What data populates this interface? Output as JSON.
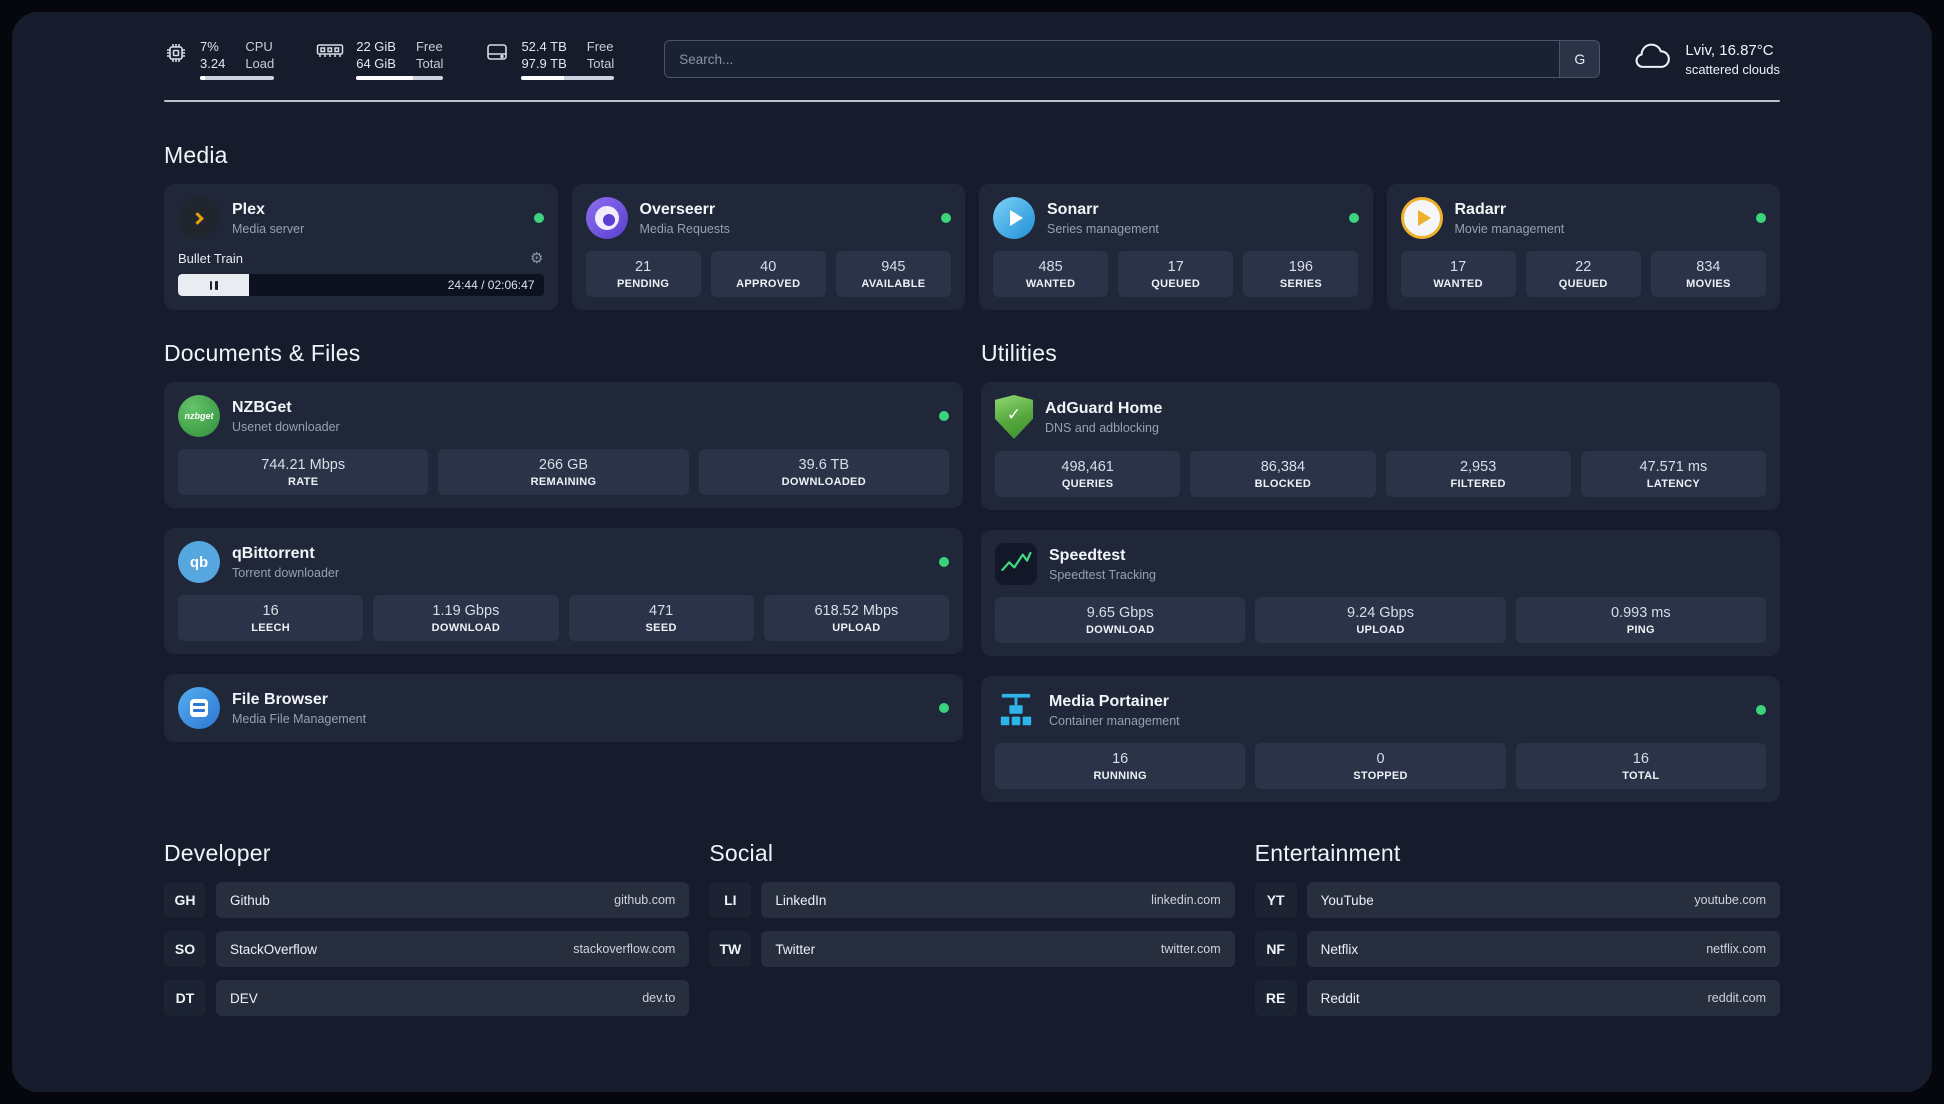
{
  "colors": {
    "accent_green": "#3bd37c",
    "background": "#161c2c",
    "card": "#1f2738",
    "tile": "#2a3347"
  },
  "topbar": {
    "system": [
      {
        "icon": "cpu-icon",
        "values": [
          "7%",
          "3.24"
        ],
        "labels": [
          "CPU",
          "Load"
        ]
      },
      {
        "icon": "memory-icon",
        "values": [
          "22 GiB",
          "64 GiB"
        ],
        "labels": [
          "Free",
          "Total"
        ]
      },
      {
        "icon": "disk-icon",
        "values": [
          "52.4 TB",
          "97.9 TB"
        ],
        "labels": [
          "Free",
          "Total"
        ]
      }
    ],
    "search": {
      "placeholder": "Search...",
      "engine_button": "G"
    },
    "weather": {
      "location": "Lviv, 16.87°C",
      "condition": "scattered clouds"
    }
  },
  "media": {
    "heading": "Media",
    "plex": {
      "title": "Plex",
      "subtitle": "Media server",
      "now_playing": "Bullet Train",
      "time": "24:44 / 02:06:47"
    },
    "overseerr": {
      "title": "Overseerr",
      "subtitle": "Media Requests",
      "stats": [
        {
          "value": "21",
          "label": "PENDING"
        },
        {
          "value": "40",
          "label": "APPROVED"
        },
        {
          "value": "945",
          "label": "AVAILABLE"
        }
      ]
    },
    "sonarr": {
      "title": "Sonarr",
      "subtitle": "Series management",
      "stats": [
        {
          "value": "485",
          "label": "WANTED"
        },
        {
          "value": "17",
          "label": "QUEUED"
        },
        {
          "value": "196",
          "label": "SERIES"
        }
      ]
    },
    "radarr": {
      "title": "Radarr",
      "subtitle": "Movie management",
      "stats": [
        {
          "value": "17",
          "label": "WANTED"
        },
        {
          "value": "22",
          "label": "QUEUED"
        },
        {
          "value": "834",
          "label": "MOVIES"
        }
      ]
    }
  },
  "documents": {
    "heading": "Documents & Files",
    "nzbget": {
      "title": "NZBGet",
      "subtitle": "Usenet downloader",
      "stats": [
        {
          "value": "744.21 Mbps",
          "label": "RATE"
        },
        {
          "value": "266 GB",
          "label": "REMAINING"
        },
        {
          "value": "39.6 TB",
          "label": "DOWNLOADED"
        }
      ]
    },
    "qbittorrent": {
      "title": "qBittorrent",
      "subtitle": "Torrent downloader",
      "stats": [
        {
          "value": "16",
          "label": "LEECH"
        },
        {
          "value": "1.19 Gbps",
          "label": "DOWNLOAD"
        },
        {
          "value": "471",
          "label": "SEED"
        },
        {
          "value": "618.52 Mbps",
          "label": "UPLOAD"
        }
      ]
    },
    "filebrowser": {
      "title": "File Browser",
      "subtitle": "Media File Management"
    }
  },
  "utilities": {
    "heading": "Utilities",
    "adguard": {
      "title": "AdGuard Home",
      "subtitle": "DNS and adblocking",
      "stats": [
        {
          "value": "498,461",
          "label": "QUERIES"
        },
        {
          "value": "86,384",
          "label": "BLOCKED"
        },
        {
          "value": "2,953",
          "label": "FILTERED"
        },
        {
          "value": "47.571 ms",
          "label": "LATENCY"
        }
      ]
    },
    "speedtest": {
      "title": "Speedtest",
      "subtitle": "Speedtest Tracking",
      "stats": [
        {
          "value": "9.65 Gbps",
          "label": "DOWNLOAD"
        },
        {
          "value": "9.24 Gbps",
          "label": "UPLOAD"
        },
        {
          "value": "0.993 ms",
          "label": "PING"
        }
      ]
    },
    "portainer": {
      "title": "Media Portainer",
      "subtitle": "Container management",
      "stats": [
        {
          "value": "16",
          "label": "RUNNING"
        },
        {
          "value": "0",
          "label": "STOPPED"
        },
        {
          "value": "16",
          "label": "TOTAL"
        }
      ]
    }
  },
  "links": {
    "developer": {
      "heading": "Developer",
      "items": [
        {
          "abbr": "GH",
          "name": "Github",
          "url": "github.com"
        },
        {
          "abbr": "SO",
          "name": "StackOverflow",
          "url": "stackoverflow.com"
        },
        {
          "abbr": "DT",
          "name": "DEV",
          "url": "dev.to"
        }
      ]
    },
    "social": {
      "heading": "Social",
      "items": [
        {
          "abbr": "LI",
          "name": "LinkedIn",
          "url": "linkedin.com"
        },
        {
          "abbr": "TW",
          "name": "Twitter",
          "url": "twitter.com"
        }
      ]
    },
    "entertainment": {
      "heading": "Entertainment",
      "items": [
        {
          "abbr": "YT",
          "name": "YouTube",
          "url": "youtube.com"
        },
        {
          "abbr": "NF",
          "name": "Netflix",
          "url": "netflix.com"
        },
        {
          "abbr": "RE",
          "name": "Reddit",
          "url": "reddit.com"
        }
      ]
    }
  },
  "icons": {
    "gear": "⚙",
    "adguard_check": "✓",
    "nzbget_label": "nzbget",
    "qbittorrent_label": "qb"
  }
}
